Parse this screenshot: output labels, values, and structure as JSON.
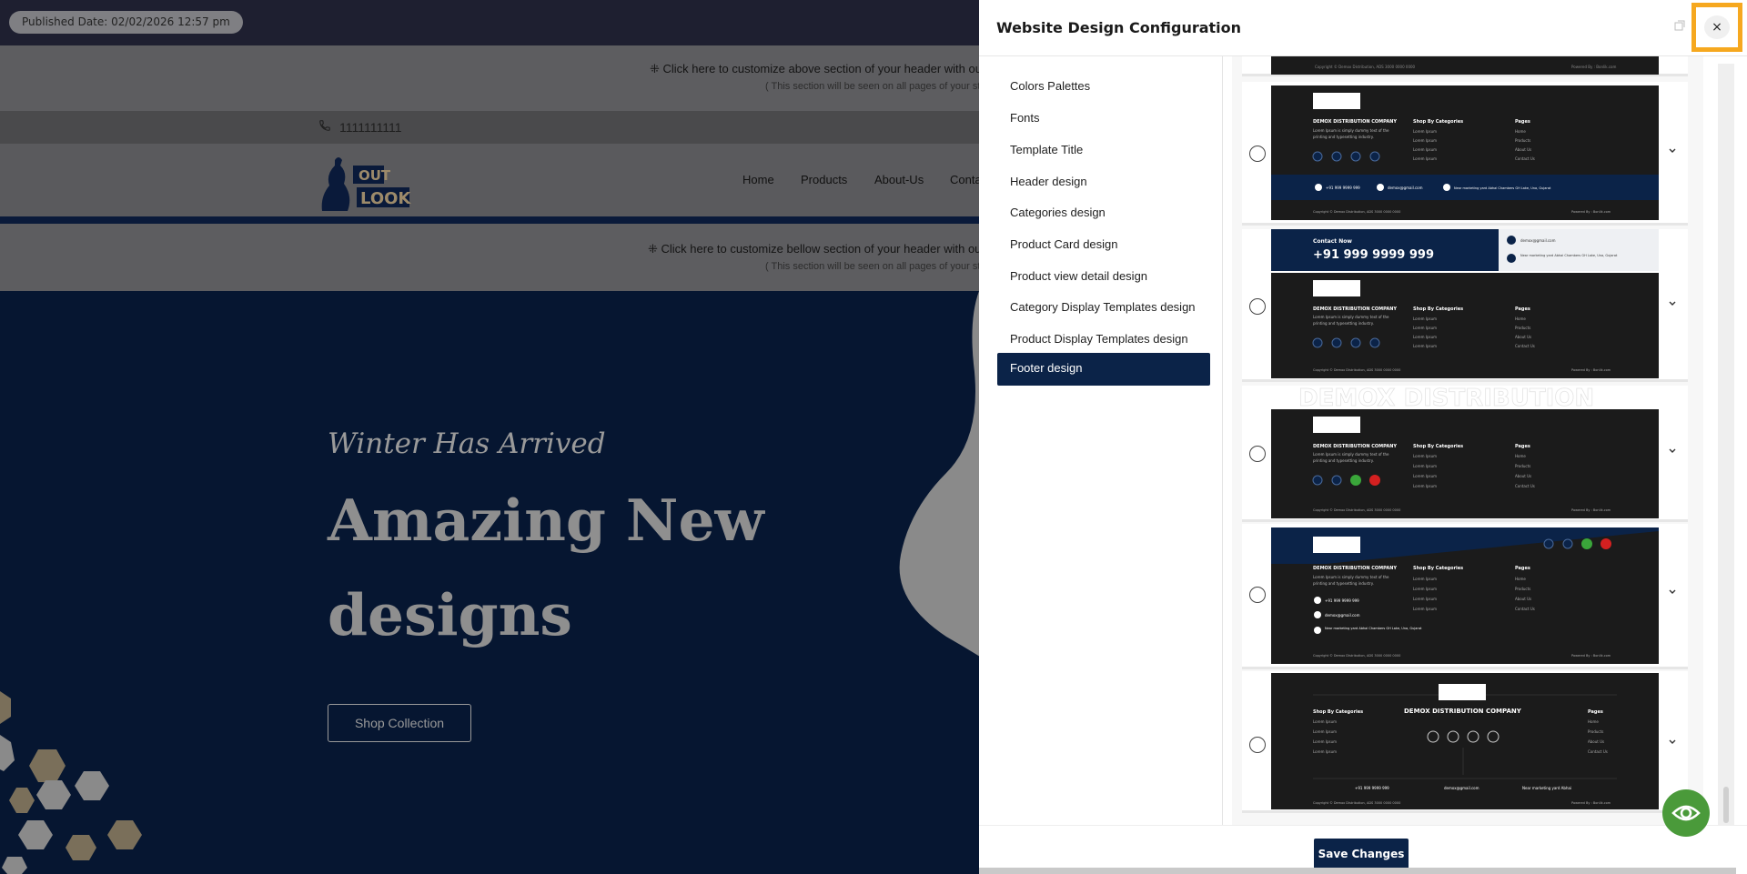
{
  "background_site": {
    "published_date": "Published Date: 02/02/2026 12:57 pm",
    "above_section": {
      "line1": "⁜ Click here to customize above section of your header with our po",
      "line2": "( This section will be seen on all pages of your store"
    },
    "phone_icon": "phone-icon",
    "phone": "1111111111",
    "logo_text": "OUT LOOK",
    "nav": [
      "Home",
      "Products",
      "About-Us",
      "Conta"
    ],
    "bellow_section": {
      "line1": "⁜ Click here to customize bellow section of your header with our po",
      "line2": "( This section will be seen on all pages of your store"
    },
    "hero": {
      "tagline": "Winter Has Arrived",
      "heading": "Amazing New designs",
      "button": "Shop Collection"
    }
  },
  "modal": {
    "title": "Website Design Configuration",
    "close_symbol": "×",
    "restore_icon": "restore-icon",
    "menu": [
      "Colors Palettes",
      "Fonts",
      "Template Title",
      "Header design",
      "Categories design",
      "Product Card design",
      "Product view detail design",
      "Category Display Templates design",
      "Product Display Templates design",
      "Footer design"
    ],
    "active_menu": "Footer design",
    "footer_preview": {
      "company": "DEMOX DISTRIBUTION COMPANY",
      "lorem": "Lorem Ipsum is simply dummy text of the",
      "lorem2": "printing and typesetting industry.",
      "shop_by": "Shop By Categories",
      "lorem_ipsum": "Lorem Ipsum",
      "pages": "Pages",
      "page_links": [
        "Home",
        "Products",
        "About Us",
        "Contact Us"
      ],
      "phone": "+91 999 9999 999",
      "email": "demox@gmail.com",
      "address": "Near marketing yard Abhai Chambers GH Lake, Una, Gujarat",
      "copyright": "Copyright © Demox Distribution, ADS 3000 0000 0000",
      "powered": "Powered By : Bonlik.com",
      "contact_now": "Contact Now",
      "contact_phone": "+91 999 9999 999",
      "watermark": "DEMOX DISTRIBUTION",
      "address_short": "Near marketing yard Abhai"
    },
    "save_button": "Save Changes",
    "preview_icon": "eye-icon"
  }
}
